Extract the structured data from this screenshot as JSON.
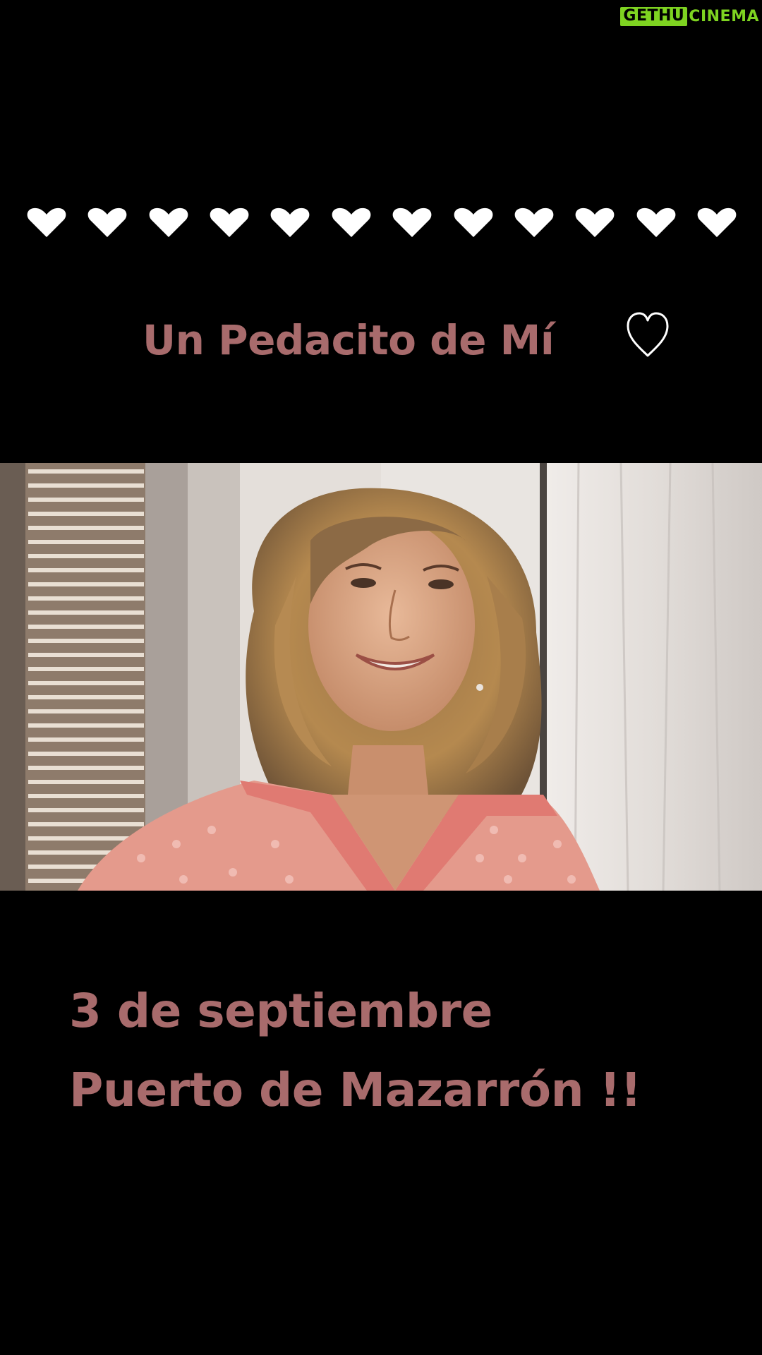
{
  "watermark": {
    "left": "GETHU",
    "right": "CINEMA",
    "color": "#7ed321"
  },
  "hearts": {
    "count": 12,
    "icon": "white-heart-icon",
    "color": "#ffffff"
  },
  "title": {
    "text": "Un Pedacito de Mí",
    "icon": "outline-heart-icon"
  },
  "event": {
    "date": "3 de septiembre",
    "place": "Puerto de Mazarrón !!"
  },
  "colors": {
    "background": "#000000",
    "text_accent": "#a86b6c"
  }
}
